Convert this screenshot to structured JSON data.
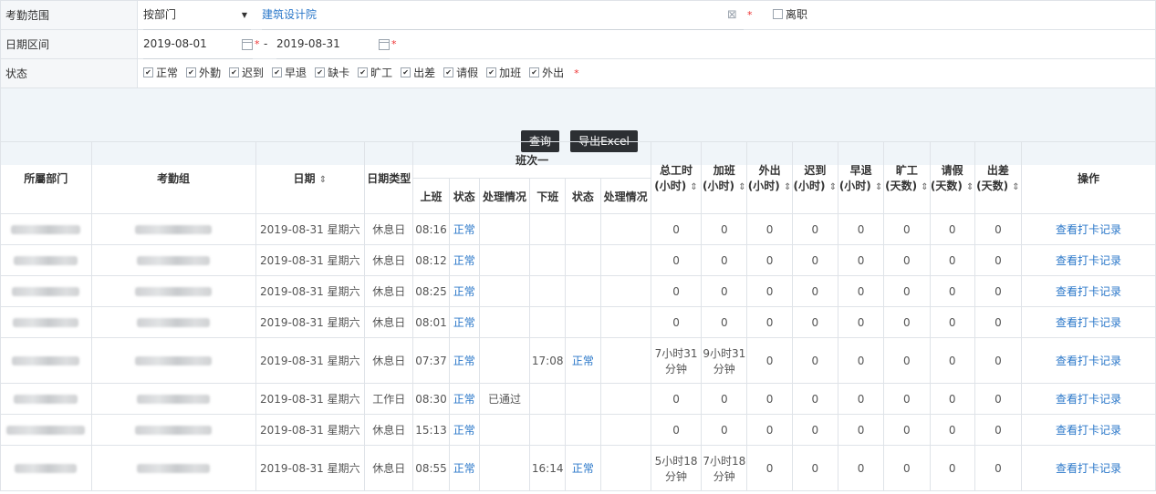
{
  "filters": {
    "scope_label": "考勤范围",
    "scope_select": "按部门",
    "scope_dept": "建筑设计院",
    "resigned_label": "离职",
    "required_mark": "*",
    "date_label": "日期区间",
    "date_start": "2019-08-01",
    "date_sep": "-",
    "date_end": "2019-08-31",
    "status_label": "状态",
    "statuses": [
      "正常",
      "外勤",
      "迟到",
      "早退",
      "缺卡",
      "旷工",
      "出差",
      "请假",
      "加班",
      "外出"
    ]
  },
  "actions": {
    "query": "查询",
    "export": "导出Excel"
  },
  "table": {
    "headers": {
      "dept": "所屬部门",
      "group": "考勤组",
      "date": "日期",
      "date_type": "日期类型",
      "shift": "班次一",
      "on": "上班",
      "status": "状态",
      "handling": "处理情况",
      "off": "下班",
      "total_hours": "总工时",
      "overtime": "加班",
      "outing": "外出",
      "late": "迟到",
      "early": "早退",
      "absent": "旷工",
      "leave": "请假",
      "trip": "出差",
      "unit_hours": "(小时)",
      "unit_days": "(天数)",
      "ops": "操作",
      "sort_icon": "⇕"
    },
    "rows": [
      {
        "date": "2019-08-31  星期六",
        "type": "休息日",
        "on": "08:16",
        "on_status": "正常",
        "handling": "",
        "off": "",
        "off_status": "",
        "off_handling": "",
        "total": "0",
        "overtime": "0",
        "outing": "0",
        "late": "0",
        "early": "0",
        "absent": "0",
        "leave": "0",
        "trip": "0",
        "op": "查看打卡记录"
      },
      {
        "date": "2019-08-31  星期六",
        "type": "休息日",
        "on": "08:12",
        "on_status": "正常",
        "handling": "",
        "off": "",
        "off_status": "",
        "off_handling": "",
        "total": "0",
        "overtime": "0",
        "outing": "0",
        "late": "0",
        "early": "0",
        "absent": "0",
        "leave": "0",
        "trip": "0",
        "op": "查看打卡记录"
      },
      {
        "date": "2019-08-31  星期六",
        "type": "休息日",
        "on": "08:25",
        "on_status": "正常",
        "handling": "",
        "off": "",
        "off_status": "",
        "off_handling": "",
        "total": "0",
        "overtime": "0",
        "outing": "0",
        "late": "0",
        "early": "0",
        "absent": "0",
        "leave": "0",
        "trip": "0",
        "op": "查看打卡记录"
      },
      {
        "date": "2019-08-31  星期六",
        "type": "休息日",
        "on": "08:01",
        "on_status": "正常",
        "handling": "",
        "off": "",
        "off_status": "",
        "off_handling": "",
        "total": "0",
        "overtime": "0",
        "outing": "0",
        "late": "0",
        "early": "0",
        "absent": "0",
        "leave": "0",
        "trip": "0",
        "op": "查看打卡记录"
      },
      {
        "date": "2019-08-31  星期六",
        "type": "休息日",
        "on": "07:37",
        "on_status": "正常",
        "handling": "",
        "off": "17:08",
        "off_status": "正常",
        "off_handling": "",
        "total": "7小时31分钟",
        "overtime": "9小时31分钟",
        "outing": "0",
        "late": "0",
        "early": "0",
        "absent": "0",
        "leave": "0",
        "trip": "0",
        "op": "查看打卡记录"
      },
      {
        "date": "2019-08-31  星期六",
        "type": "工作日",
        "on": "08:30",
        "on_status": "正常",
        "handling": "已通过",
        "off": "",
        "off_status": "",
        "off_handling": "",
        "total": "0",
        "overtime": "0",
        "outing": "0",
        "late": "0",
        "early": "0",
        "absent": "0",
        "leave": "0",
        "trip": "0",
        "op": "查看打卡记录"
      },
      {
        "date": "2019-08-31  星期六",
        "type": "休息日",
        "on": "15:13",
        "on_status": "正常",
        "handling": "",
        "off": "",
        "off_status": "",
        "off_handling": "",
        "total": "0",
        "overtime": "0",
        "outing": "0",
        "late": "0",
        "early": "0",
        "absent": "0",
        "leave": "0",
        "trip": "0",
        "op": "查看打卡记录"
      },
      {
        "date": "2019-08-31  星期六",
        "type": "休息日",
        "on": "08:55",
        "on_status": "正常",
        "handling": "",
        "off": "16:14",
        "off_status": "正常",
        "off_handling": "",
        "total": "5小时18分钟",
        "overtime": "7小时18分钟",
        "outing": "0",
        "late": "0",
        "early": "0",
        "absent": "0",
        "leave": "0",
        "trip": "0",
        "op": "查看打卡记录"
      }
    ]
  }
}
